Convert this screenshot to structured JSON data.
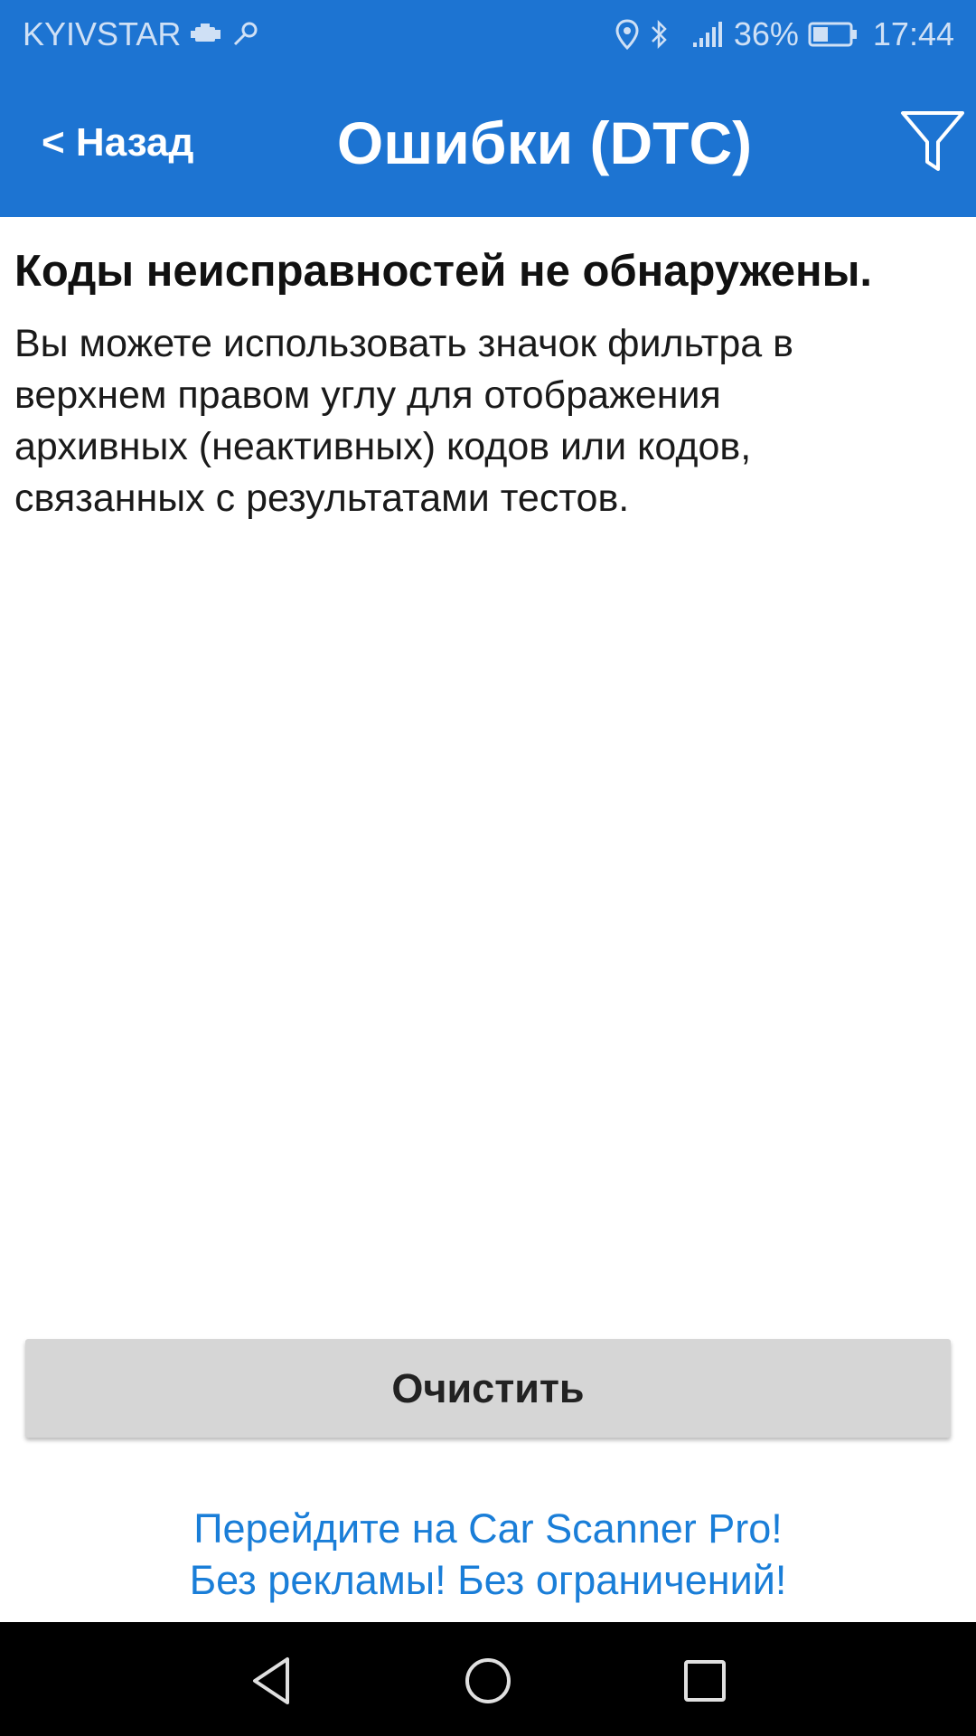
{
  "status_bar": {
    "carrier": "KYIVSTAR",
    "battery_percent": "36%",
    "time": "17:44",
    "icons": [
      "car-engine-icon",
      "key-icon",
      "location-icon",
      "bluetooth-icon",
      "signal-icon",
      "battery-icon"
    ]
  },
  "app_bar": {
    "back_label": "< Назад",
    "title": "Ошибки (DTC)",
    "filter_icon": "filter-icon"
  },
  "content": {
    "heading": "Коды неисправностей не обнаружены.",
    "description": "Вы можете использовать значок фильтра в верхнем правом углу для отображения архивных (неактивных) кодов или кодов, связанных с результатами тестов."
  },
  "actions": {
    "clear_label": "Очистить"
  },
  "promo": {
    "line1": "Перейдите на Car Scanner Pro!",
    "line2": "Без рекламы! Без ограничений!"
  },
  "nav_bar": {
    "icons": [
      "back-triangle-icon",
      "home-circle-icon",
      "recents-square-icon"
    ]
  },
  "colors": {
    "primary": "#1d74d2",
    "link": "#1a7ed8",
    "button_bg": "#d6d6d6"
  }
}
